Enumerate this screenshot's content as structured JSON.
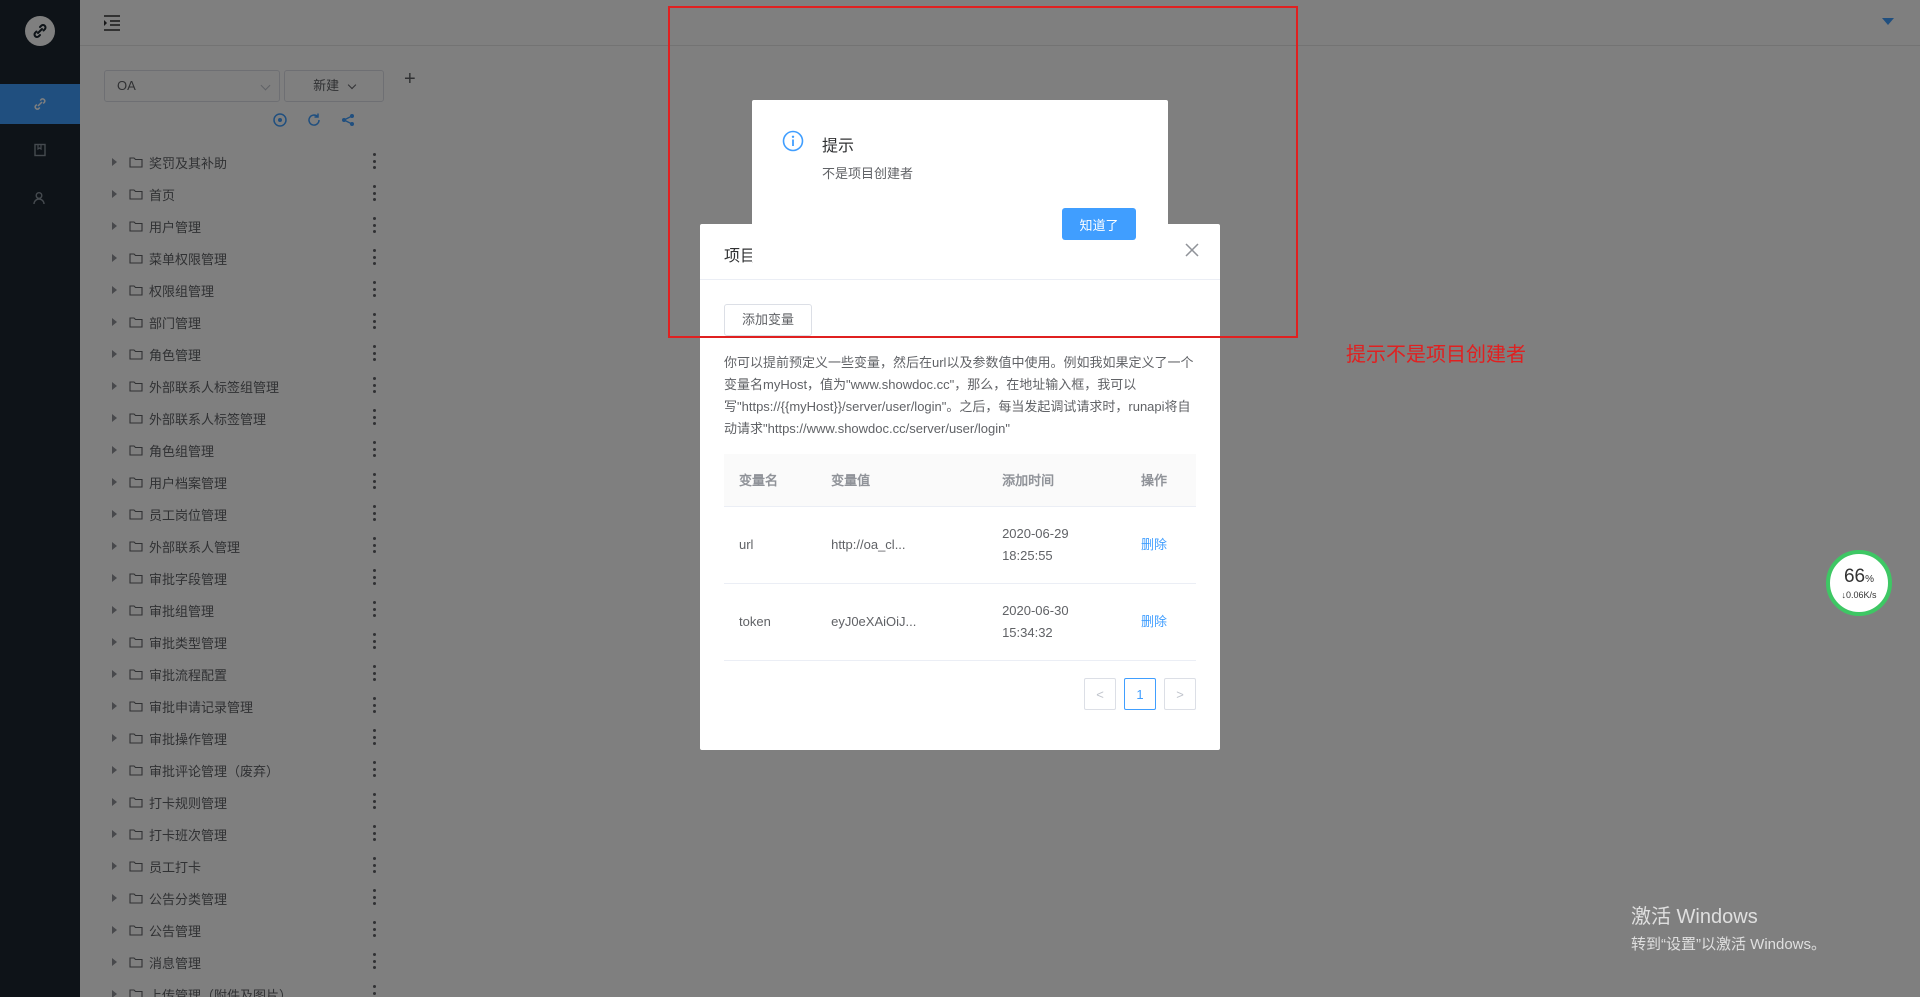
{
  "header": {
    "menu_toggle": "menu-fold-icon",
    "user_menu": "caret-down-icon"
  },
  "rail": {
    "logo": "link-icon",
    "items": [
      {
        "icon": "link-icon",
        "active": true
      },
      {
        "icon": "notebook-icon",
        "active": false
      },
      {
        "icon": "user-icon",
        "active": false
      }
    ]
  },
  "tree": {
    "project_select": "OA",
    "new_button": "新建",
    "add_tab": "+",
    "tools": [
      "settings-icon",
      "refresh-icon",
      "share-icon"
    ],
    "items": [
      "奖罚及其补助",
      "首页",
      "用户管理",
      "菜单权限管理",
      "权限组管理",
      "部门管理",
      "角色管理",
      "外部联系人标签组管理",
      "外部联系人标签管理",
      "角色组管理",
      "用户档案管理",
      "员工岗位管理",
      "外部联系人管理",
      "审批字段管理",
      "审批组管理",
      "审批类型管理",
      "审批流程配置",
      "审批申请记录管理",
      "审批操作管理",
      "审批评论管理（废弃）",
      "打卡规则管理",
      "打卡班次管理",
      "员工打卡",
      "公告分类管理",
      "公告管理",
      "消息管理",
      "上传管理（附件及图片）"
    ]
  },
  "env_dialog": {
    "title": "项目",
    "add_button": "添加变量",
    "description": "你可以提前预定义一些变量，然后在url以及参数值中使用。例如我如果定义了一个变量名myHost，值为\"www.showdoc.cc\"，那么，在地址输入框，我可以写\"https://{{myHost}}/server/user/login\"。之后，每当发起调试请求时，runapi将自动请求\"https://www.showdoc.cc/server/user/login\"",
    "columns": [
      "变量名",
      "变量值",
      "添加时间",
      "操作"
    ],
    "rows": [
      {
        "name": "url",
        "value": "http://oa_cl...",
        "time1": "2020-06-29",
        "time2": "18:25:55",
        "action": "删除"
      },
      {
        "name": "token",
        "value": "eyJ0eXAiOiJ...",
        "time1": "2020-06-30",
        "time2": "15:34:32",
        "action": "删除"
      }
    ],
    "pagination": {
      "prev": "<",
      "current": "1",
      "next": ">"
    }
  },
  "alert": {
    "title": "提示",
    "message": "不是项目创建者",
    "ok_button": "知道了"
  },
  "annotation": {
    "note": "提示不是项目创建者",
    "color": "#e02020"
  },
  "speed_widget": {
    "percent": "66",
    "unit": "%",
    "rate": "↓0.06K/s"
  },
  "watermark": {
    "line1": "激活 Windows",
    "line2": "转到“设置”以激活 Windows。"
  },
  "colors": {
    "accent": "#409eff",
    "rail": "#1d2730",
    "speed_ring": "#3ec764"
  }
}
